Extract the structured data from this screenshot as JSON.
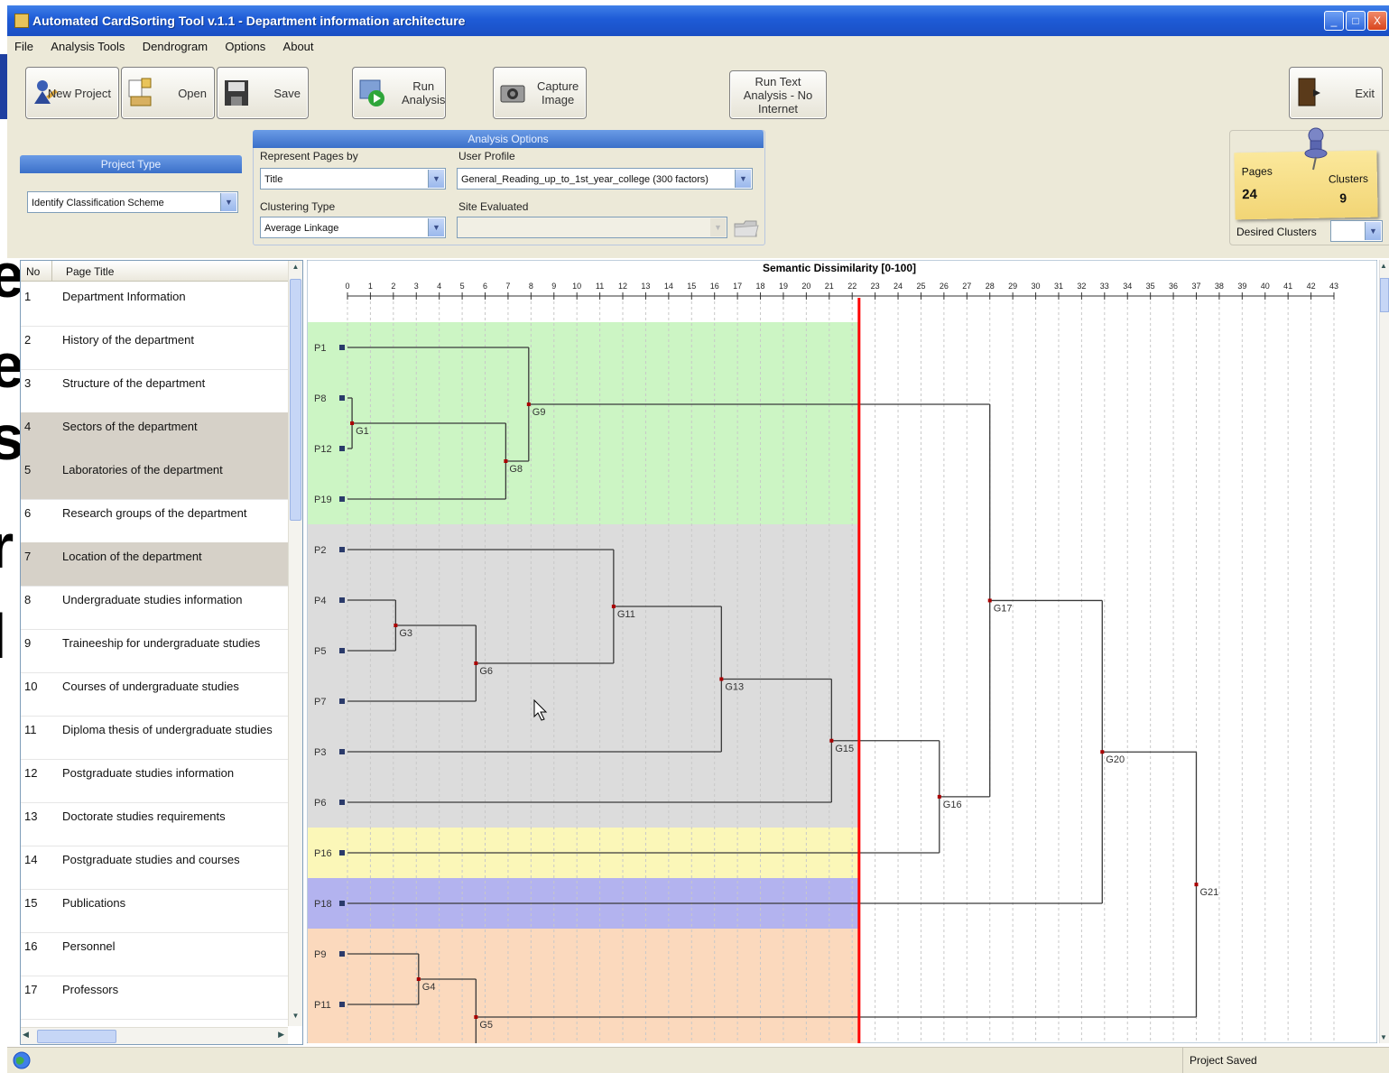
{
  "window": {
    "title": "Automated CardSorting Tool v.1.1 - Department information architecture",
    "controls": [
      "_",
      "□",
      "X"
    ]
  },
  "menu": [
    "File",
    "Analysis Tools",
    "Dendrogram",
    "Options",
    "About"
  ],
  "toolbar": {
    "new_project": "New Project",
    "open": "Open",
    "save": "Save",
    "run_analysis": "Run Analysis",
    "capture_image": "Capture Image",
    "run_text_analysis": "Run Text Analysis - No Internet",
    "exit": "Exit"
  },
  "project_type": {
    "header": "Project Type",
    "value": "Identify Classification Scheme"
  },
  "analysis_options": {
    "header": "Analysis Options",
    "represent_label": "Represent Pages by",
    "represent_value": "Title",
    "profile_label": "User Profile",
    "profile_value": "General_Reading_up_to_1st_year_college (300 factors)",
    "clustering_label": "Clustering Type",
    "clustering_value": "Average Linkage",
    "site_label": "Site Evaluated",
    "site_value": ""
  },
  "stats": {
    "pages_label": "Pages",
    "pages_value": "24",
    "clusters_label": "Clusters",
    "clusters_value": "9",
    "desired_label": "Desired Clusters",
    "desired_value": ""
  },
  "page_list": {
    "col_no": "No",
    "col_title": "Page Title",
    "rows": [
      {
        "no": "1",
        "title": "Department Information",
        "selected": false
      },
      {
        "no": "2",
        "title": "History of the department",
        "selected": false
      },
      {
        "no": "3",
        "title": "Structure of the department",
        "selected": false
      },
      {
        "no": "4",
        "title": "Sectors of the department",
        "selected": true
      },
      {
        "no": "5",
        "title": "Laboratories of the department",
        "selected": true
      },
      {
        "no": "6",
        "title": "Research groups of the department",
        "selected": false
      },
      {
        "no": "7",
        "title": "Location of the department",
        "selected": true
      },
      {
        "no": "8",
        "title": "Undergraduate studies information",
        "selected": false
      },
      {
        "no": "9",
        "title": "Traineeship for undergraduate studies",
        "selected": false
      },
      {
        "no": "10",
        "title": "Courses of undergraduate studies",
        "selected": false
      },
      {
        "no": "11",
        "title": "Diploma thesis of undergraduate studies",
        "selected": false
      },
      {
        "no": "12",
        "title": "Postgraduate studies information",
        "selected": false
      },
      {
        "no": "13",
        "title": "Doctorate studies requirements",
        "selected": false
      },
      {
        "no": "14",
        "title": "Postgraduate studies  and courses",
        "selected": false
      },
      {
        "no": "15",
        "title": "Publications",
        "selected": false
      },
      {
        "no": "16",
        "title": "Personnel",
        "selected": false
      },
      {
        "no": "17",
        "title": "Professors",
        "selected": false
      }
    ]
  },
  "dendrogram": {
    "axis_title": "Semantic Dissimilarity [0-100]",
    "axis_min": 0,
    "axis_max": 43,
    "cut_level": 22.3,
    "bands": [
      {
        "color": "#ccf5c4",
        "leaves": 4
      },
      {
        "color": "#dcdcdc",
        "leaves": 6
      },
      {
        "color": "#fbf7b8",
        "leaves": 1
      },
      {
        "color": "#b3b3ef",
        "leaves": 1
      },
      {
        "color": "#fbd9bd",
        "leaves": 3
      }
    ],
    "leaves": [
      "P1",
      "P8",
      "P12",
      "P19",
      "P2",
      "P4",
      "P5",
      "P7",
      "P3",
      "P6",
      "P16",
      "P18",
      "P9",
      "P11",
      ""
    ],
    "nodes": [
      {
        "name": "G1",
        "level": 0.2,
        "children": [
          "P8",
          "P12"
        ]
      },
      {
        "name": "G8",
        "level": 6.9,
        "children": [
          "G1",
          "P19"
        ]
      },
      {
        "name": "G9",
        "level": 7.9,
        "children": [
          "P1",
          "G8"
        ]
      },
      {
        "name": "G3",
        "level": 2.1,
        "children": [
          "P4",
          "P5"
        ]
      },
      {
        "name": "G6",
        "level": 5.6,
        "children": [
          "G3",
          "P7"
        ]
      },
      {
        "name": "G11",
        "level": 11.6,
        "children": [
          "P2",
          "G6"
        ]
      },
      {
        "name": "G13",
        "level": 16.3,
        "children": [
          "G11",
          "P3"
        ]
      },
      {
        "name": "G15",
        "level": 21.1,
        "children": [
          "G13",
          "P6"
        ]
      },
      {
        "name": "G16",
        "level": 25.8,
        "children": [
          "G15",
          "P16"
        ]
      },
      {
        "name": "G17",
        "level": 28.0,
        "children": [
          "G9",
          "G16"
        ]
      },
      {
        "name": "G20",
        "level": 32.9,
        "children": [
          "G17",
          "P18"
        ]
      },
      {
        "name": "G4",
        "level": 3.1,
        "children": [
          "P9",
          "P11"
        ]
      },
      {
        "name": "G5",
        "level": 5.6,
        "children": [
          "G4",
          ""
        ]
      },
      {
        "name": "G21",
        "level": 37.0,
        "children": [
          "G20",
          "G5"
        ]
      }
    ]
  },
  "status": {
    "message": "Project Saved"
  },
  "colors": {
    "title_bar": "#1e5bd6",
    "cut_line": "#ff0000",
    "panel_header": "#3b70c9"
  }
}
